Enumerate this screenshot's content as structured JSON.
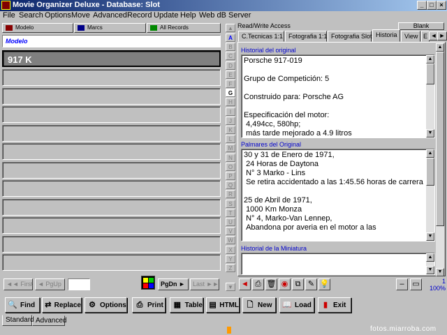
{
  "window": {
    "title": "Movie Organizer Deluxe - Database: Slot"
  },
  "menu": [
    {
      "label": "File"
    },
    {
      "label": "Search"
    },
    {
      "label": "Options"
    },
    {
      "label": "Move"
    },
    {
      "label": "Advanced"
    },
    {
      "label": "Record"
    },
    {
      "label": "Update"
    },
    {
      "label": "Help"
    },
    {
      "label": "Web dB Server"
    }
  ],
  "left": {
    "headers": {
      "col1": "Modelo",
      "col2": "Marcs",
      "col3": "All Records"
    },
    "field_label": "Modelo",
    "selected_record": "917 K"
  },
  "alpha": [
    "A",
    "B",
    "C",
    "D",
    "E",
    "F",
    "G",
    "H",
    "I",
    "J",
    "K",
    "L",
    "M",
    "N",
    "O",
    "P",
    "Q",
    "R",
    "S",
    "T",
    "U",
    "V",
    "W",
    "X",
    "Y",
    "Z"
  ],
  "nav": {
    "first": "First",
    "pgup": "PgUp",
    "pgdn": "PgDn",
    "last": "Last"
  },
  "right": {
    "access": "Read/Write Access",
    "blank": "Blank",
    "tabs": [
      "C.Tecnicas 1:1",
      "Fotografia 1:1",
      "Fotografia Slot",
      "Historia",
      "View",
      "E"
    ],
    "active_tab": "Historia",
    "sections": {
      "historial_label": "Historial del original",
      "historial_text": "Porsche 917-019\n\nGrupo de Competición: 5\n\nConstruido para: Porsche AG\n\nEspecificación del motor:\n 4,494cc, 580hp;\n más tarde mejorado a 4.9 litros",
      "palmares_label": "Palmares del Original",
      "palmares_text": "30 y 31 de Enero de 1971,\n 24 Horas de Daytona\n N° 3 Marko - Lins\n Se retira accidentado a las 1:45.56 horas de carrera\n\n25 de Abril de 1971,\n 1000 Km Monza\n N° 4, Marko-Van Lennep,\n Abandona por averia en el motor a las",
      "miniatura_label": "Historial de la Miniatura",
      "miniatura_text": ""
    },
    "status": {
      "count": "1",
      "zoom": "100%"
    }
  },
  "toolbar": {
    "find": "Find",
    "replace": "Replace",
    "options": "Options",
    "print": "Print",
    "table": "Table",
    "html": "HTML",
    "new": "New",
    "load": "Load",
    "exit": "Exit"
  },
  "bottom_tabs": {
    "standard": "Standard",
    "advanced": "Advanced"
  },
  "watermark": "fotos.miarroba.com"
}
